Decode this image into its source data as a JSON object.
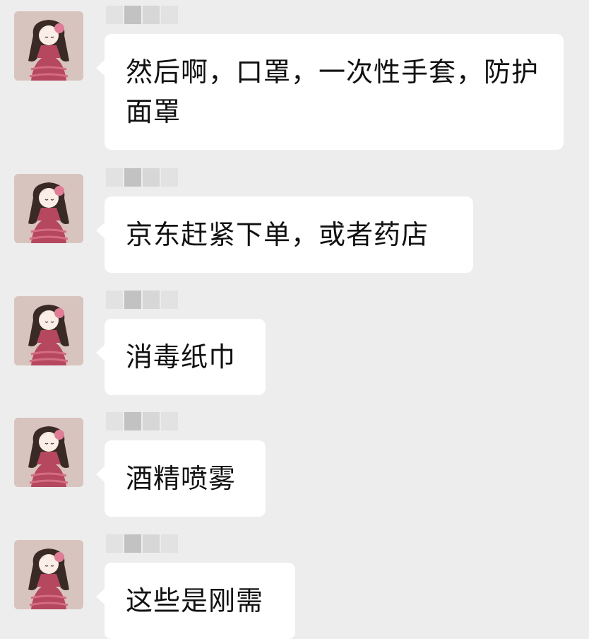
{
  "messages": [
    {
      "text": "然后啊，口罩，一次性手套，防护面罩"
    },
    {
      "text": "京东赶紧下单，或者药店"
    },
    {
      "text": "消毒纸巾"
    },
    {
      "text": "酒精喷雾"
    },
    {
      "text": "这些是刚需"
    }
  ],
  "colors": {
    "background": "#ededed",
    "bubble": "#ffffff",
    "text": "#111111",
    "avatar_dress": "#b5475e"
  },
  "icons": {
    "avatar": "girl-avatar-icon"
  }
}
